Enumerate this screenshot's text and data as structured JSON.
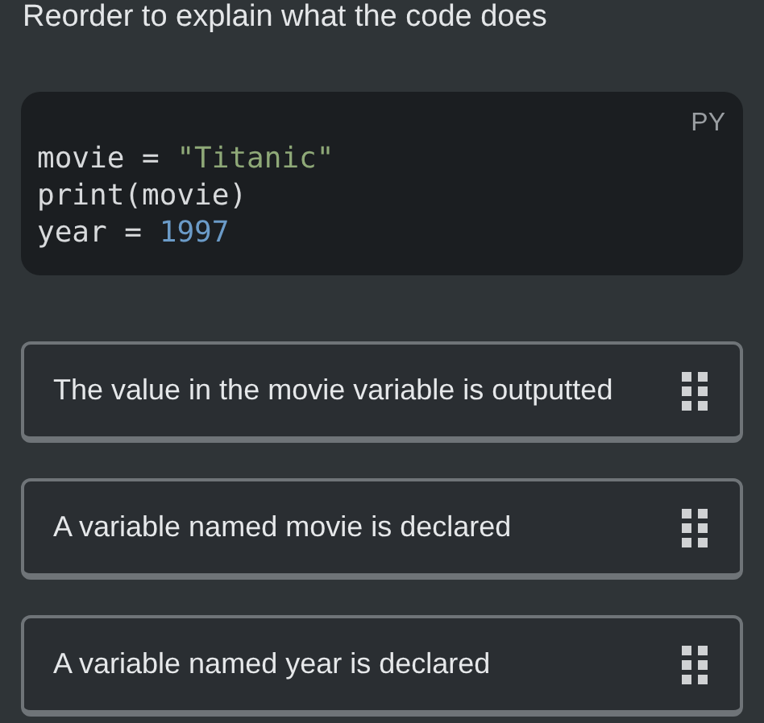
{
  "title": "Reorder to explain what the code does",
  "code": {
    "language": "PY",
    "lines": [
      [
        {
          "text": "movie = ",
          "kind": "plain"
        },
        {
          "text": "\"Titanic\"",
          "kind": "string"
        }
      ],
      [
        {
          "text": "print(movie)",
          "kind": "plain"
        }
      ],
      [
        {
          "text": "year = ",
          "kind": "plain"
        },
        {
          "text": "1997",
          "kind": "number"
        }
      ]
    ]
  },
  "options": [
    {
      "text": "The value in the movie variable is outputted"
    },
    {
      "text": "A variable named movie is declared"
    },
    {
      "text": "A variable named year is declared"
    }
  ]
}
